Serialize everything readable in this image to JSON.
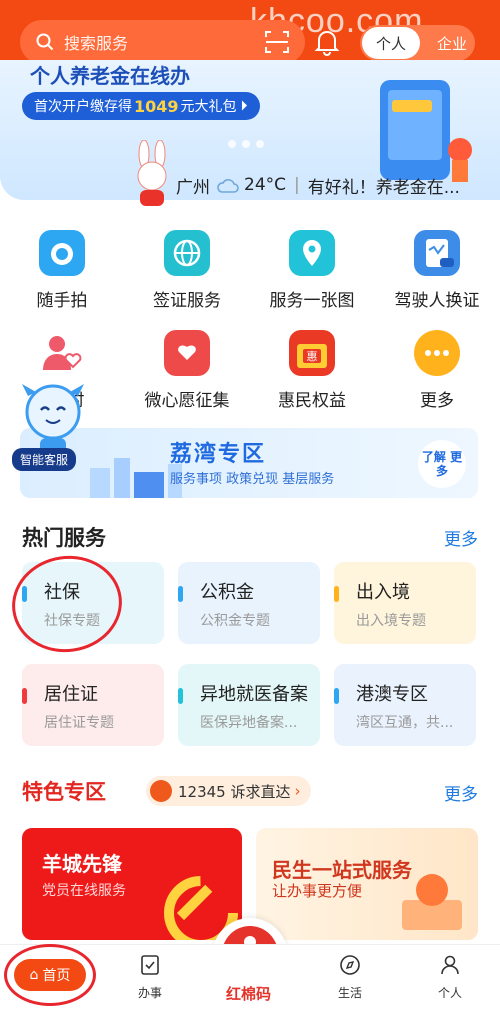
{
  "header": {
    "search_placeholder": "搜索服务",
    "toggle_personal": "个人",
    "toggle_enterprise": "企业",
    "watermark": "khcoo.com"
  },
  "banner": {
    "title": "个人养老金在线办",
    "promo_prefix": "首次开户缴存得",
    "promo_amount": "1049",
    "promo_suffix": "元大礼包"
  },
  "info": {
    "city": "广州",
    "temperature": "24°C",
    "notice": "有好礼！养老金在..."
  },
  "grid": [
    {
      "label": "随手拍",
      "icon": "camera-icon",
      "color": "#2ea7f2"
    },
    {
      "label": "签证服务",
      "icon": "globe-icon",
      "color": "#25c0cf"
    },
    {
      "label": "服务一张图",
      "icon": "map-pin-icon",
      "color": "#22c3d8"
    },
    {
      "label": "驾驶人换证",
      "icon": "clipboard-car-icon",
      "color": "#3d8de8"
    },
    {
      "label": "时",
      "icon": "heart-user-icon",
      "color": "#ee5a6a"
    },
    {
      "label": "微心愿征集",
      "icon": "heart-card-icon",
      "color": "#ee4a4a"
    },
    {
      "label": "惠民权益",
      "icon": "gift-hui-icon",
      "color": "#ea3a26"
    },
    {
      "label": "更多",
      "icon": "more-dots-icon",
      "color": "#ffb21c"
    }
  ],
  "assistant": {
    "label": "智能客服"
  },
  "lizhou": {
    "title": "荔湾专区",
    "subtitle": "服务事项  政策兑现  基层服务",
    "button": "了解 更多"
  },
  "hot": {
    "title": "热门服务",
    "more": "更多",
    "cards": [
      {
        "title": "社保",
        "sub": "社保专题",
        "bar": "#2ea7f2",
        "bg": "#e6f6fb"
      },
      {
        "title": "公积金",
        "sub": "公积金专题",
        "bar": "#2ea7f2",
        "bg": "#e9f3fd"
      },
      {
        "title": "出入境",
        "sub": "出入境专题",
        "bar": "#ffb21c",
        "bg": "#fff4dc"
      },
      {
        "title": "居住证",
        "sub": "居住证专题",
        "bar": "#ef3b3b",
        "bg": "#fdeceb"
      },
      {
        "title": "异地就医备案",
        "sub": "医保异地备案...",
        "bar": "#22c3d8",
        "bg": "#e3f7f8"
      },
      {
        "title": "港澳专区",
        "sub": "湾区互通，共...",
        "bar": "#2ea7f2",
        "bg": "#e9f2fd"
      }
    ]
  },
  "featured": {
    "title": "特色专区",
    "hotline": "12345 诉求直达",
    "more": "更多",
    "card1_title": "羊城先锋",
    "card1_sub": "党员在线服务",
    "card2_title": "民生一站式服务",
    "card2_sub": "让办事更方便"
  },
  "nav": {
    "home": "首页",
    "tasks": "办事",
    "center": "红棉码",
    "life": "生活",
    "personal": "个人"
  }
}
